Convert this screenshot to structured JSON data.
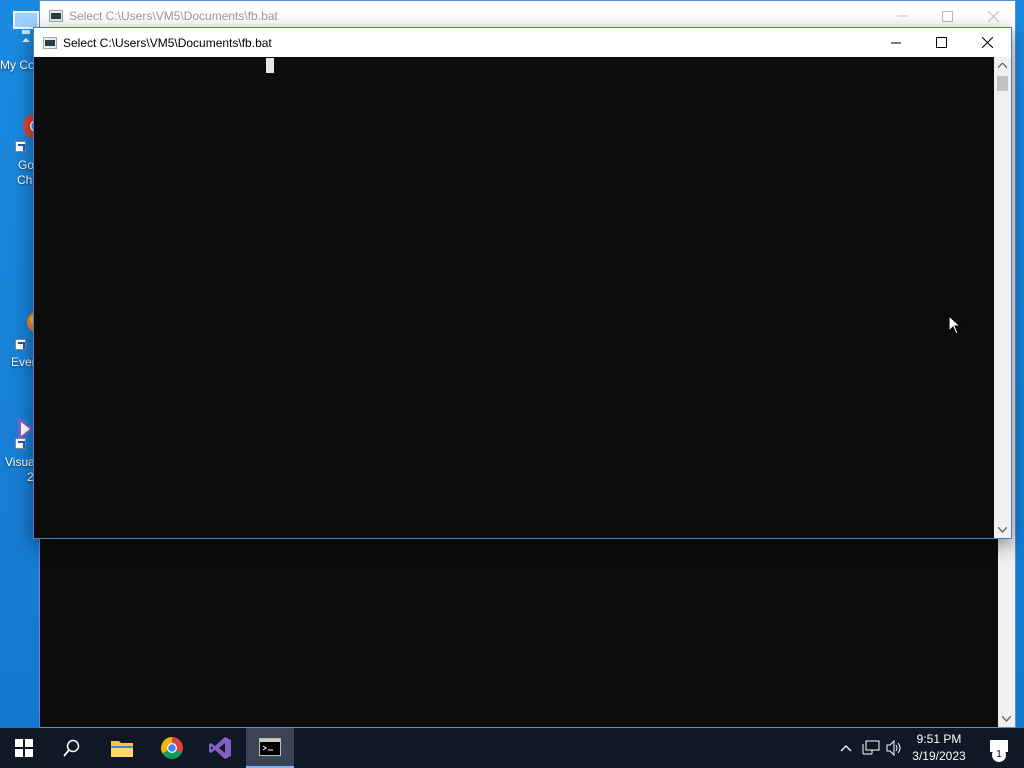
{
  "desktop": {
    "icons": [
      {
        "label": "My Co",
        "name": "my-computer"
      },
      {
        "label": "Go",
        "label2": "Ch",
        "name": "google-chrome"
      },
      {
        "label": "Ever",
        "name": "everything"
      },
      {
        "label": "Visua",
        "label2": "2",
        "name": "visual-studio"
      }
    ]
  },
  "back_window": {
    "title": "Select C:\\Users\\VM5\\Documents\\fb.bat"
  },
  "front_window": {
    "title": "Select C:\\Users\\VM5\\Documents\\fb.bat"
  },
  "taskbar": {
    "apps": [
      "start",
      "search",
      "file-explorer",
      "chrome",
      "visual-studio",
      "command-prompt"
    ],
    "active_app": "command-prompt",
    "clock": {
      "time": "9:51 PM",
      "date": "3/19/2023"
    },
    "notification_count": "1"
  },
  "colors": {
    "desktop": "#1c84d8",
    "console_bg": "#0c0c0c",
    "taskbar": "#101826"
  }
}
